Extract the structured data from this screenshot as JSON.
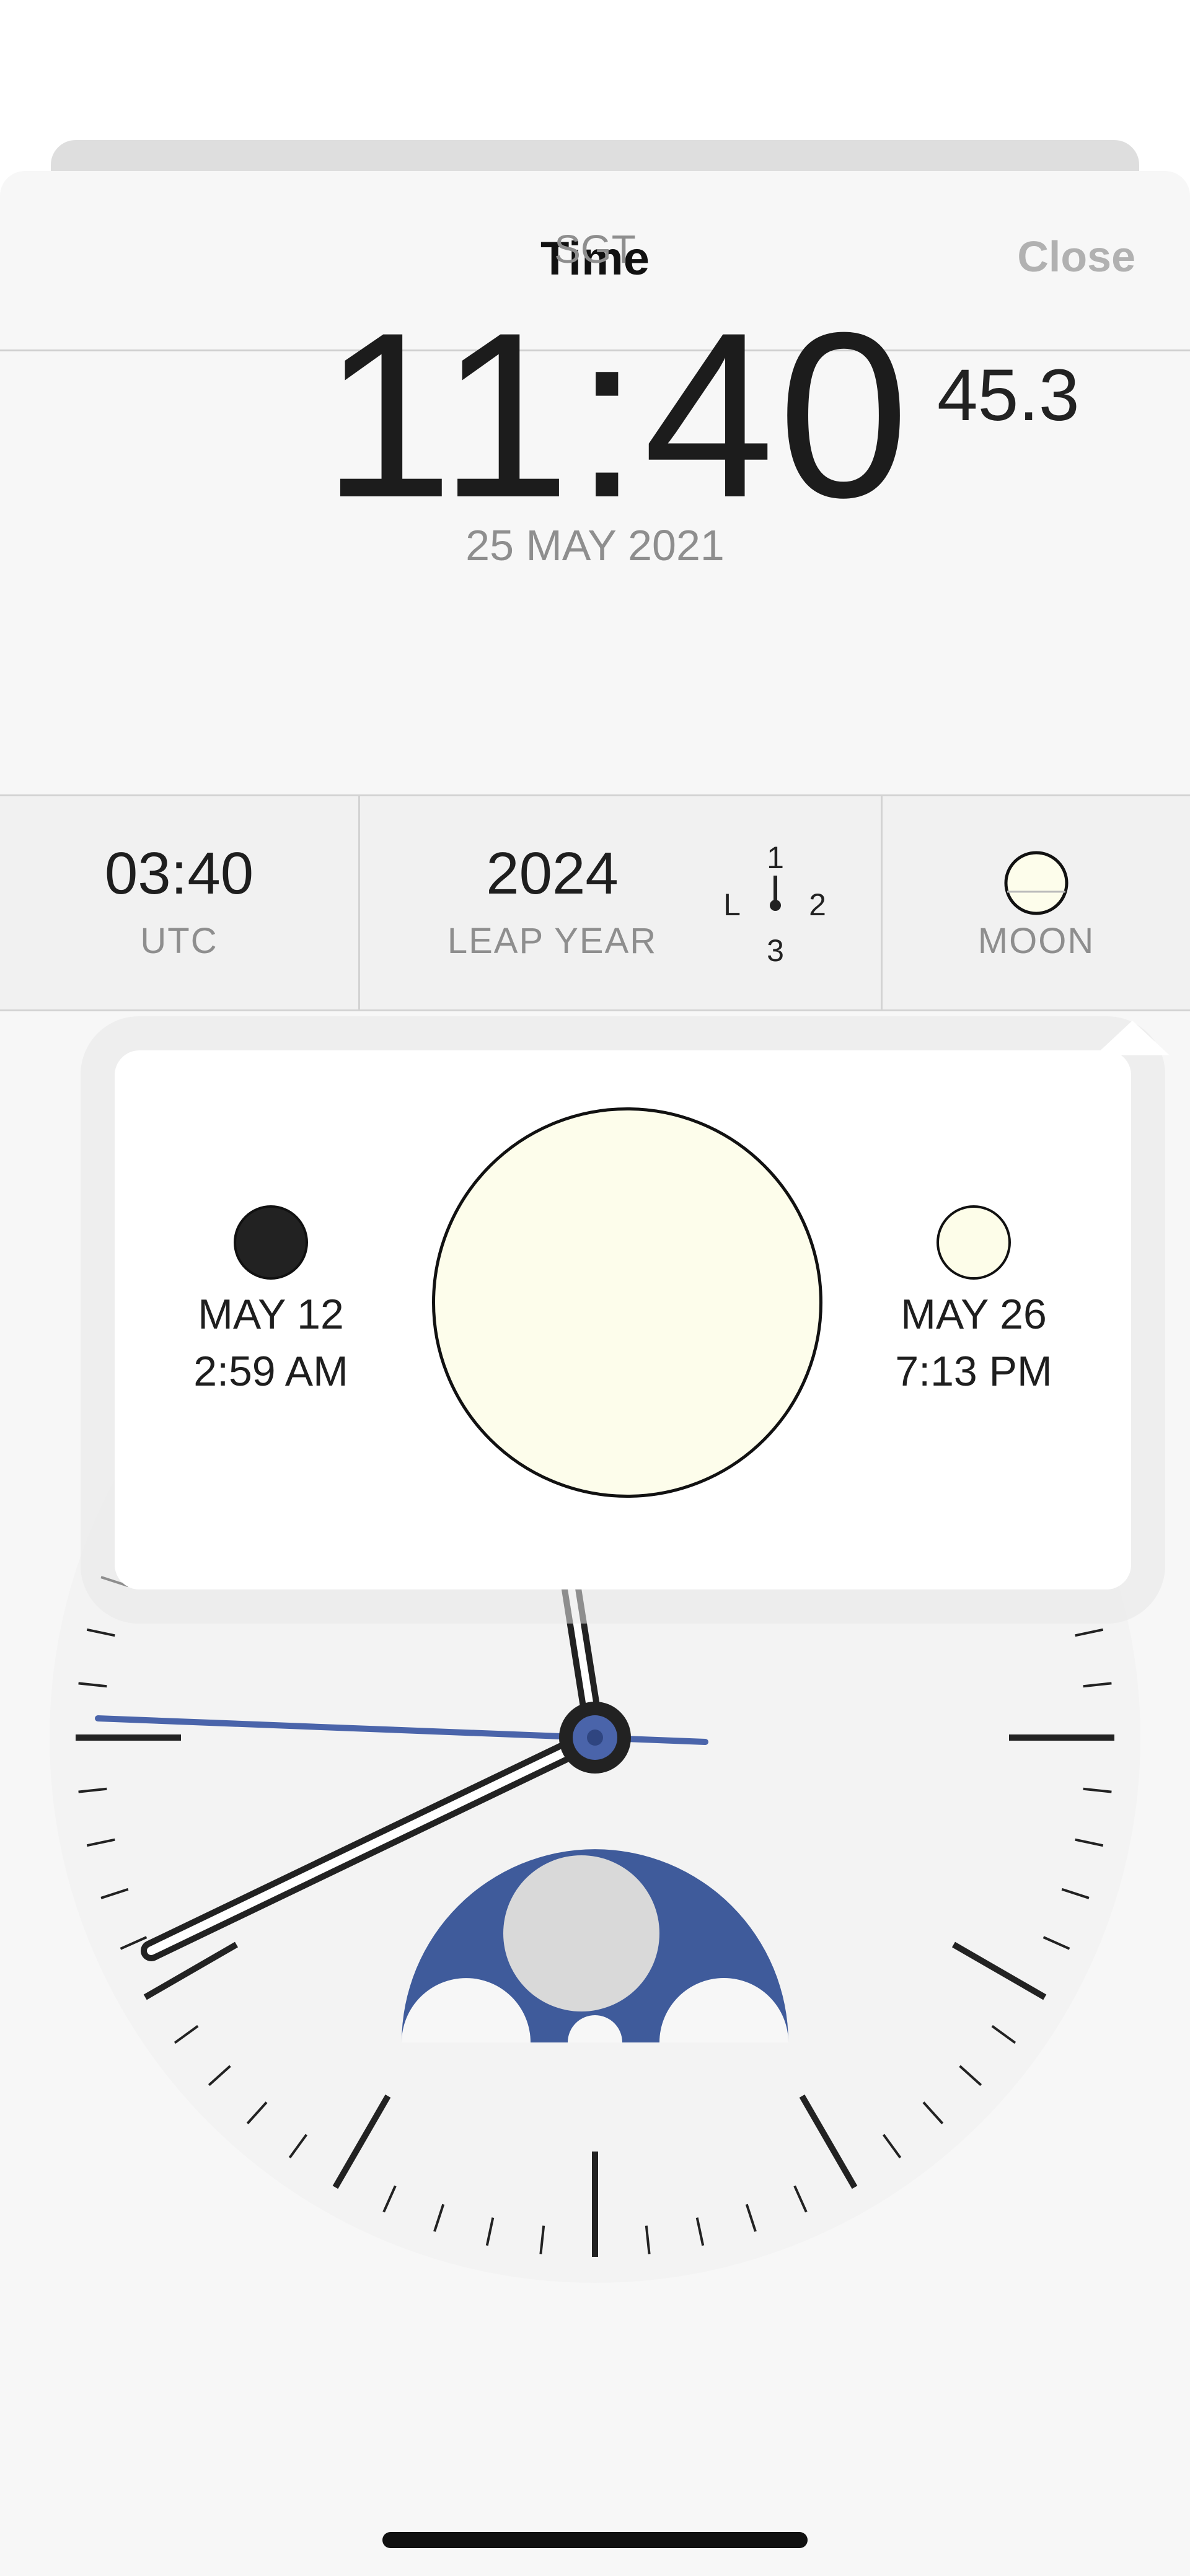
{
  "header": {
    "title": "Time",
    "close_label": "Close"
  },
  "main_time": {
    "timezone": "SGT",
    "time": "11:40",
    "seconds": "45.3",
    "date": "25 MAY 2021"
  },
  "info_cells": {
    "utc": {
      "value": "03:40",
      "label": "UTC"
    },
    "leap": {
      "value": "2024",
      "label": "LEAP YEAR",
      "indicator": {
        "top": "1",
        "right": "2",
        "bottom": "3",
        "left": "L"
      }
    },
    "moon": {
      "label": "MOON",
      "phase": "full"
    }
  },
  "moon_popover": {
    "new_moon": {
      "date": "MAY 12",
      "time": "2:59 AM"
    },
    "full_moon": {
      "date": "MAY 26",
      "time": "7:13 PM"
    },
    "current_phase": "full"
  },
  "clock": {
    "hour_hand": "11:40",
    "second_hand_seconds": 45.3,
    "moon_disc": "full"
  },
  "colors": {
    "accent_blue": "#3f5b9b",
    "moon_fill": "#fdfdeb",
    "close_gray": "#b1b1b1"
  }
}
